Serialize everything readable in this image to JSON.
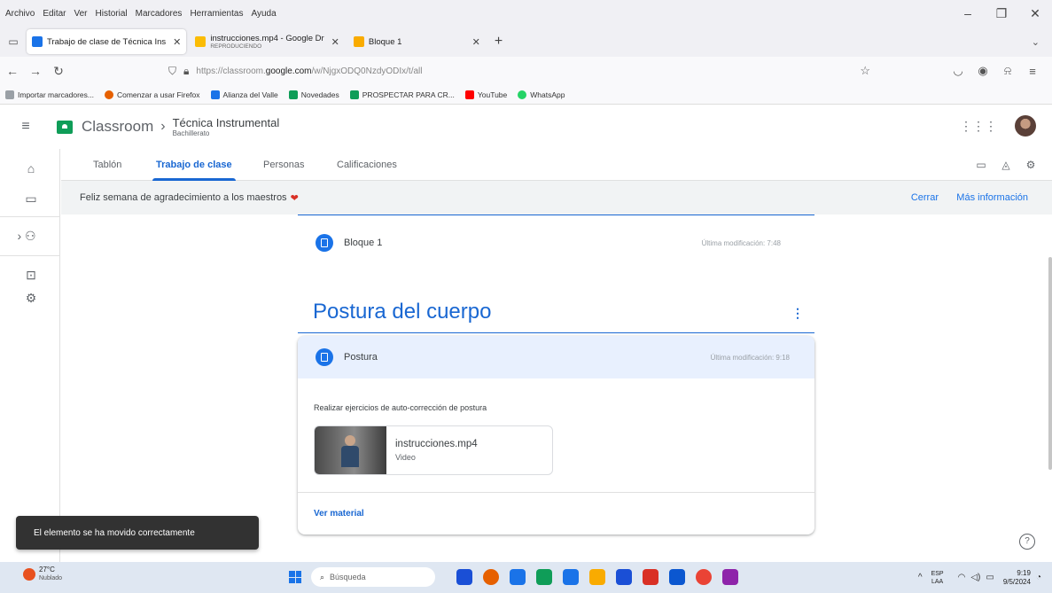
{
  "browser": {
    "menu": [
      "Archivo",
      "Editar",
      "Ver",
      "Historial",
      "Marcadores",
      "Herramientas",
      "Ayuda"
    ],
    "window_controls": {
      "minimize": "–",
      "maximize": "❐",
      "close": "✕"
    },
    "tabs": [
      {
        "label": "Trabajo de clase de Técnica Ins",
        "sub": "",
        "color": "#1a73e8",
        "active": true
      },
      {
        "label": "instrucciones.mp4 - Google Dr",
        "sub": "REPRODUCIENDO",
        "color": "#fbbc04",
        "active": false
      },
      {
        "label": "Bloque 1",
        "sub": "",
        "color": "#f9ab00",
        "active": false
      }
    ],
    "url_prefix": "https://classroom.",
    "url_host": "google.com",
    "url_path": "/w/NjgxODQ0NzdyODIx/t/all",
    "bookmarks": [
      {
        "label": "Importar marcadores...",
        "color": "#9aa0a6"
      },
      {
        "label": "Comenzar a usar Firefox",
        "color": "#e66000"
      },
      {
        "label": "Alianza del Valle",
        "color": "#1a73e8"
      },
      {
        "label": "Novedades",
        "color": "#0f9d58"
      },
      {
        "label": "PROSPECTAR PARA CR...",
        "color": "#0f9d58"
      },
      {
        "label": "YouTube",
        "color": "#ff0000"
      },
      {
        "label": "WhatsApp",
        "color": "#25d366"
      }
    ]
  },
  "classroom": {
    "app_name": "Classroom",
    "course_title": "Técnica Instrumental",
    "course_subtitle": "Bachillerato",
    "tabs": [
      "Tablón",
      "Trabajo de clase",
      "Personas",
      "Calificaciones"
    ],
    "active_tab": "Trabajo de clase",
    "banner": {
      "text": "Feliz semana de agradecimiento a los maestros",
      "heart": "❤",
      "close": "Cerrar",
      "more": "Más información"
    },
    "prev_item": {
      "title": "Bloque 1",
      "modified": "Última modificación: 7:48"
    },
    "topic": "Postura del cuerpo",
    "material": {
      "title": "Postura",
      "modified": "Última modificación: 9:18",
      "description": "Realizar ejercicios de auto-corrección de postura",
      "attachment_name": "instrucciones.mp4",
      "attachment_type": "Video",
      "link": "Ver material"
    },
    "snackbar": "El elemento se ha movido correctamente"
  },
  "taskbar": {
    "temp": "27°C",
    "weather": "Nublado",
    "search_placeholder": "Búsqueda",
    "app_colors": [
      "#1a4fd6",
      "#e66000",
      "#1a73e8",
      "#0f9d58",
      "#1a73e8",
      "#f9ab00",
      "#1a4fd6",
      "#d93025",
      "#0b57d0",
      "#ea4335",
      "#8e24aa"
    ],
    "lang_top": "ESP",
    "lang_bottom": "LAA",
    "time": "9:19",
    "date": "9/5/2024"
  }
}
